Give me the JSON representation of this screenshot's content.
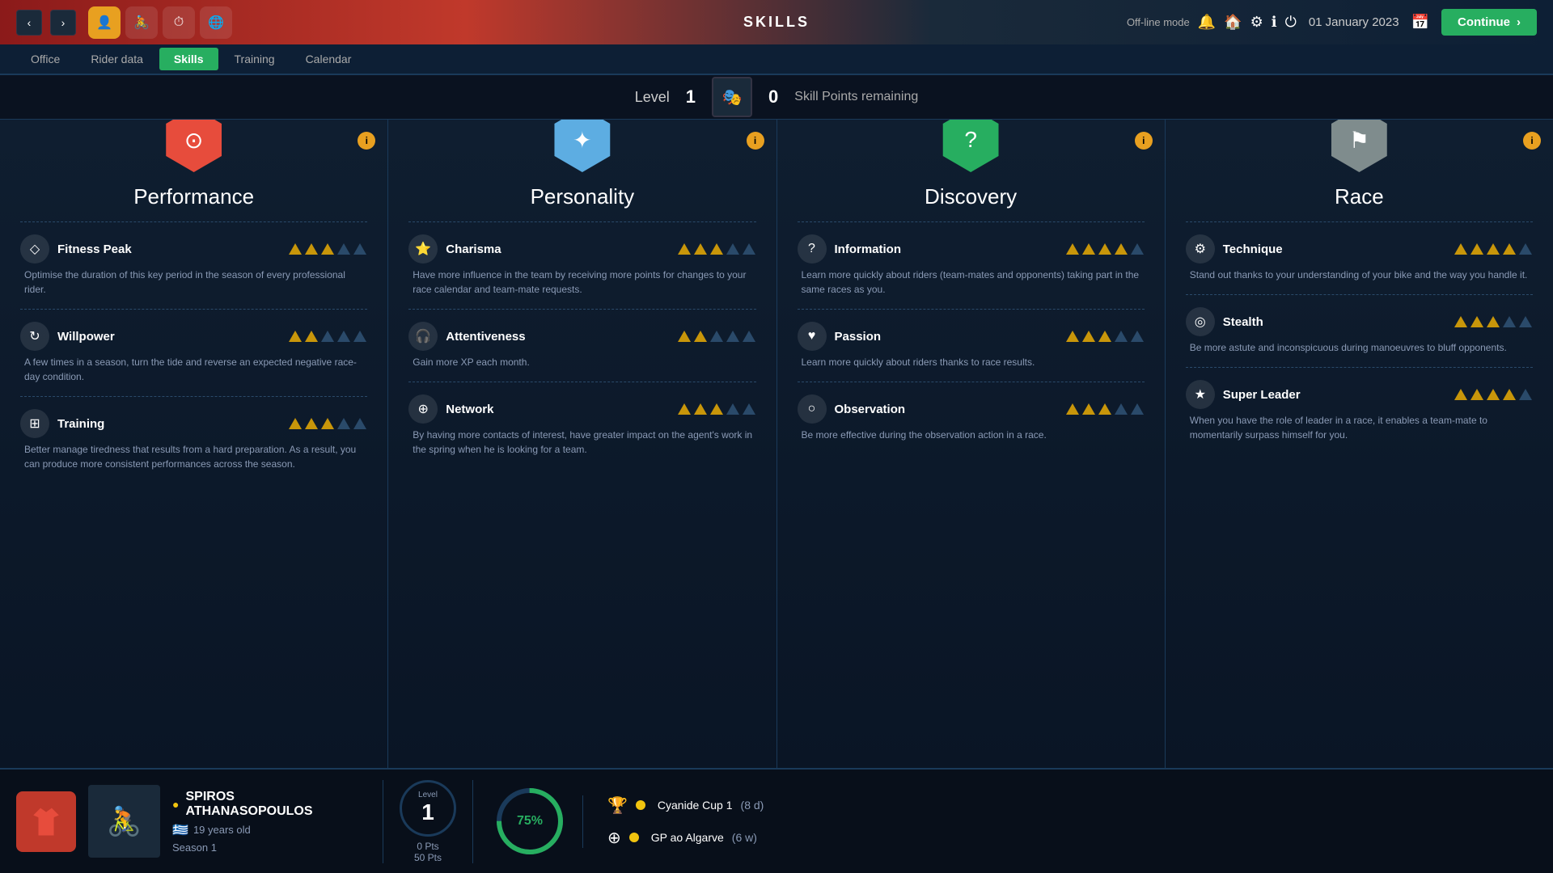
{
  "topBar": {
    "title": "SKILLS",
    "mode": "Off-line mode",
    "date": "01 January 2023",
    "continueLabel": "Continue"
  },
  "tabs": [
    {
      "label": "Office",
      "active": false
    },
    {
      "label": "Rider data",
      "active": false
    },
    {
      "label": "Skills",
      "active": true
    },
    {
      "label": "Training",
      "active": false
    },
    {
      "label": "Calendar",
      "active": false
    }
  ],
  "levelBar": {
    "levelLabel": "Level",
    "levelNum": "1",
    "skillPointsNum": "0",
    "skillPointsLabel": "Skill Points remaining"
  },
  "cards": [
    {
      "id": "performance",
      "title": "Performance",
      "hexColor": "performance",
      "skills": [
        {
          "name": "Fitness Peak",
          "icon": "◇",
          "desc": "Optimise the duration of this key period in the season of every professional rider.",
          "stars": 3,
          "maxStars": 5
        },
        {
          "name": "Willpower",
          "icon": "↻",
          "desc": "A few times in a season, turn the tide and reverse an expected negative race-day condition.",
          "stars": 2,
          "maxStars": 5
        },
        {
          "name": "Training",
          "icon": "⊞",
          "desc": "Better manage tiredness that results from a hard preparation. As a result, you can produce more consistent performances across the season.",
          "stars": 3,
          "maxStars": 5
        }
      ]
    },
    {
      "id": "personality",
      "title": "Personality",
      "hexColor": "personality",
      "skills": [
        {
          "name": "Charisma",
          "icon": "⭐",
          "desc": "Have more influence in the team by receiving more points for changes to your race calendar and team-mate requests.",
          "stars": 3,
          "maxStars": 5
        },
        {
          "name": "Attentiveness",
          "icon": "🎧",
          "desc": "Gain more XP each month.",
          "stars": 2,
          "maxStars": 5
        },
        {
          "name": "Network",
          "icon": "⊕",
          "desc": "By having more contacts of interest, have greater impact on the agent's work in the spring when he is looking for a team.",
          "stars": 3,
          "maxStars": 5
        }
      ]
    },
    {
      "id": "discovery",
      "title": "Discovery",
      "hexColor": "discovery",
      "skills": [
        {
          "name": "Information",
          "icon": "?",
          "desc": "Learn more quickly about riders (team-mates and opponents) taking part in the same races as you.",
          "stars": 4,
          "maxStars": 5
        },
        {
          "name": "Passion",
          "icon": "♥",
          "desc": "Learn more quickly about riders thanks to race results.",
          "stars": 3,
          "maxStars": 5
        },
        {
          "name": "Observation",
          "icon": "○",
          "desc": "Be more effective during the observation action in a race.",
          "stars": 3,
          "maxStars": 5
        }
      ]
    },
    {
      "id": "race",
      "title": "Race",
      "hexColor": "race",
      "skills": [
        {
          "name": "Technique",
          "icon": "⚙",
          "desc": "Stand out thanks to your understanding of your bike and the way you handle it.",
          "stars": 4,
          "maxStars": 5
        },
        {
          "name": "Stealth",
          "icon": "◎",
          "desc": "Be more astute and inconspicuous during manoeuvres to bluff opponents.",
          "stars": 3,
          "maxStars": 5
        },
        {
          "name": "Super Leader",
          "icon": "★",
          "desc": "When you have the role of leader in a race, it enables a team-mate to momentarily surpass himself for you.",
          "stars": 4,
          "maxStars": 5
        }
      ]
    }
  ],
  "bottomBar": {
    "riderName": "SPIROS ATHANASOPOULOS",
    "riderAge": "19 years old",
    "riderSeason": "Season 1",
    "levelLabel": "Level",
    "levelNum": "1",
    "pts": "0 Pts",
    "totalPts": "50 Pts",
    "progressPct": "75%",
    "races": [
      {
        "icon": "🏆",
        "name": "Cyanide Cup 1",
        "date": "(8 d)"
      },
      {
        "icon": "⊕",
        "name": "GP ao Algarve",
        "date": "(6 w)"
      }
    ]
  }
}
